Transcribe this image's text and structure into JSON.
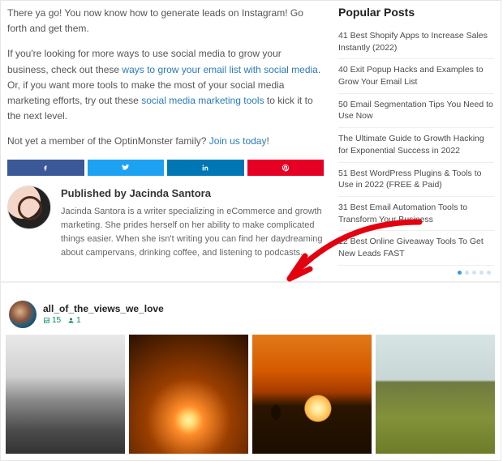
{
  "article": {
    "p1": "There ya go! You now know how to generate leads on Instagram! Go forth and get them.",
    "p2a": "If you're looking for more ways to use social media to grow your business, check out these ",
    "p2_link1": "ways to grow your email list with social media",
    "p2b": ". Or, if you want more tools to make the most of your social media marketing efforts, try out these ",
    "p2_link2": "social media marketing tools",
    "p2c": " to kick it to the next level.",
    "p3a": "Not yet a member of the OptinMonster family? ",
    "p3_link": "Join us today",
    "p3b": "!"
  },
  "author": {
    "published_by": "Published by Jacinda Santora",
    "bio": "Jacinda Santora is a writer specializing in eCommerce and growth marketing. She prides herself on her ability to make complicated things easier. When she isn't writing you can find her daydreaming about campervans, drinking coffee, and listening to podcasts."
  },
  "sidebar": {
    "heading": "Popular Posts",
    "posts": [
      "41 Best Shopify Apps to Increase Sales Instantly (2022)",
      "40 Exit Popup Hacks and Examples to Grow Your Email List",
      "50 Email Segmentation Tips You Need to Use Now",
      "The Ultimate Guide to Growth Hacking for Exponential Success in 2022",
      "51 Best WordPress Plugins & Tools to Use in 2022 (FREE & Paid)",
      "31 Best Email Automation Tools to Transform Your Business",
      "12 Best Online Giveaway Tools To Get New Leads FAST"
    ]
  },
  "insta": {
    "username": "all_of_the_views_we_love",
    "post_count": "15",
    "follower_count": "1"
  }
}
